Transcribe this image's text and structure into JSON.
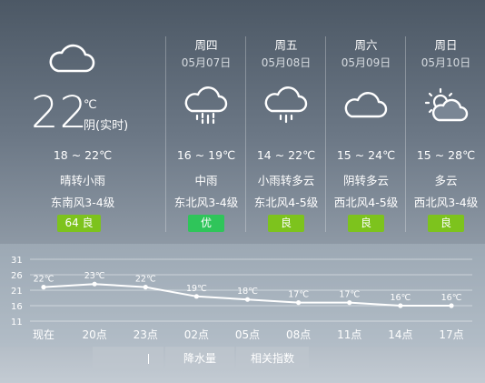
{
  "today": {
    "icon": "cloud-icon",
    "temp": "22",
    "unit": "℃",
    "condition": "阴(实时)",
    "range": "18 ~ 22℃",
    "desc": "晴转小雨",
    "wind": "东南风3-4级",
    "aqi": "64 良",
    "aqi_color": "#7dc31d"
  },
  "forecast": [
    {
      "name": "周四",
      "date": "05月07日",
      "icon": "rain-cloud-icon",
      "range": "16 ~ 19℃",
      "desc": "中雨",
      "wind": "东北风3-4级",
      "aqi": "优",
      "aqi_color": "#2fc55a"
    },
    {
      "name": "周五",
      "date": "05月08日",
      "icon": "light-rain-cloud-icon",
      "range": "14 ~ 22℃",
      "desc": "小雨转多云",
      "wind": "东北风4-5级",
      "aqi": "良",
      "aqi_color": "#7dc31d"
    },
    {
      "name": "周六",
      "date": "05月09日",
      "icon": "cloud-icon",
      "range": "15 ~ 24℃",
      "desc": "阴转多云",
      "wind": "西北风4-5级",
      "aqi": "良",
      "aqi_color": "#7dc31d"
    },
    {
      "name": "周日",
      "date": "05月10日",
      "icon": "partly-cloudy-icon",
      "range": "15 ~ 28℃",
      "desc": "多云",
      "wind": "西北风3-4级",
      "aqi": "良",
      "aqi_color": "#7dc31d"
    }
  ],
  "chart_data": {
    "type": "line",
    "categories": [
      "现在",
      "20点",
      "23点",
      "02点",
      "05点",
      "08点",
      "11点",
      "14点",
      "17点"
    ],
    "values": [
      22,
      23,
      22,
      19,
      18,
      17,
      17,
      16,
      16
    ],
    "value_labels": [
      "22℃",
      "23℃",
      "22℃",
      "19℃",
      "18℃",
      "17℃",
      "17℃",
      "16℃",
      "16℃"
    ],
    "y_ticks": [
      31,
      26,
      21,
      16,
      11
    ],
    "ylim": [
      11,
      31
    ],
    "grid": true
  },
  "tabs": [
    "",
    "降水量",
    "相关指数"
  ]
}
